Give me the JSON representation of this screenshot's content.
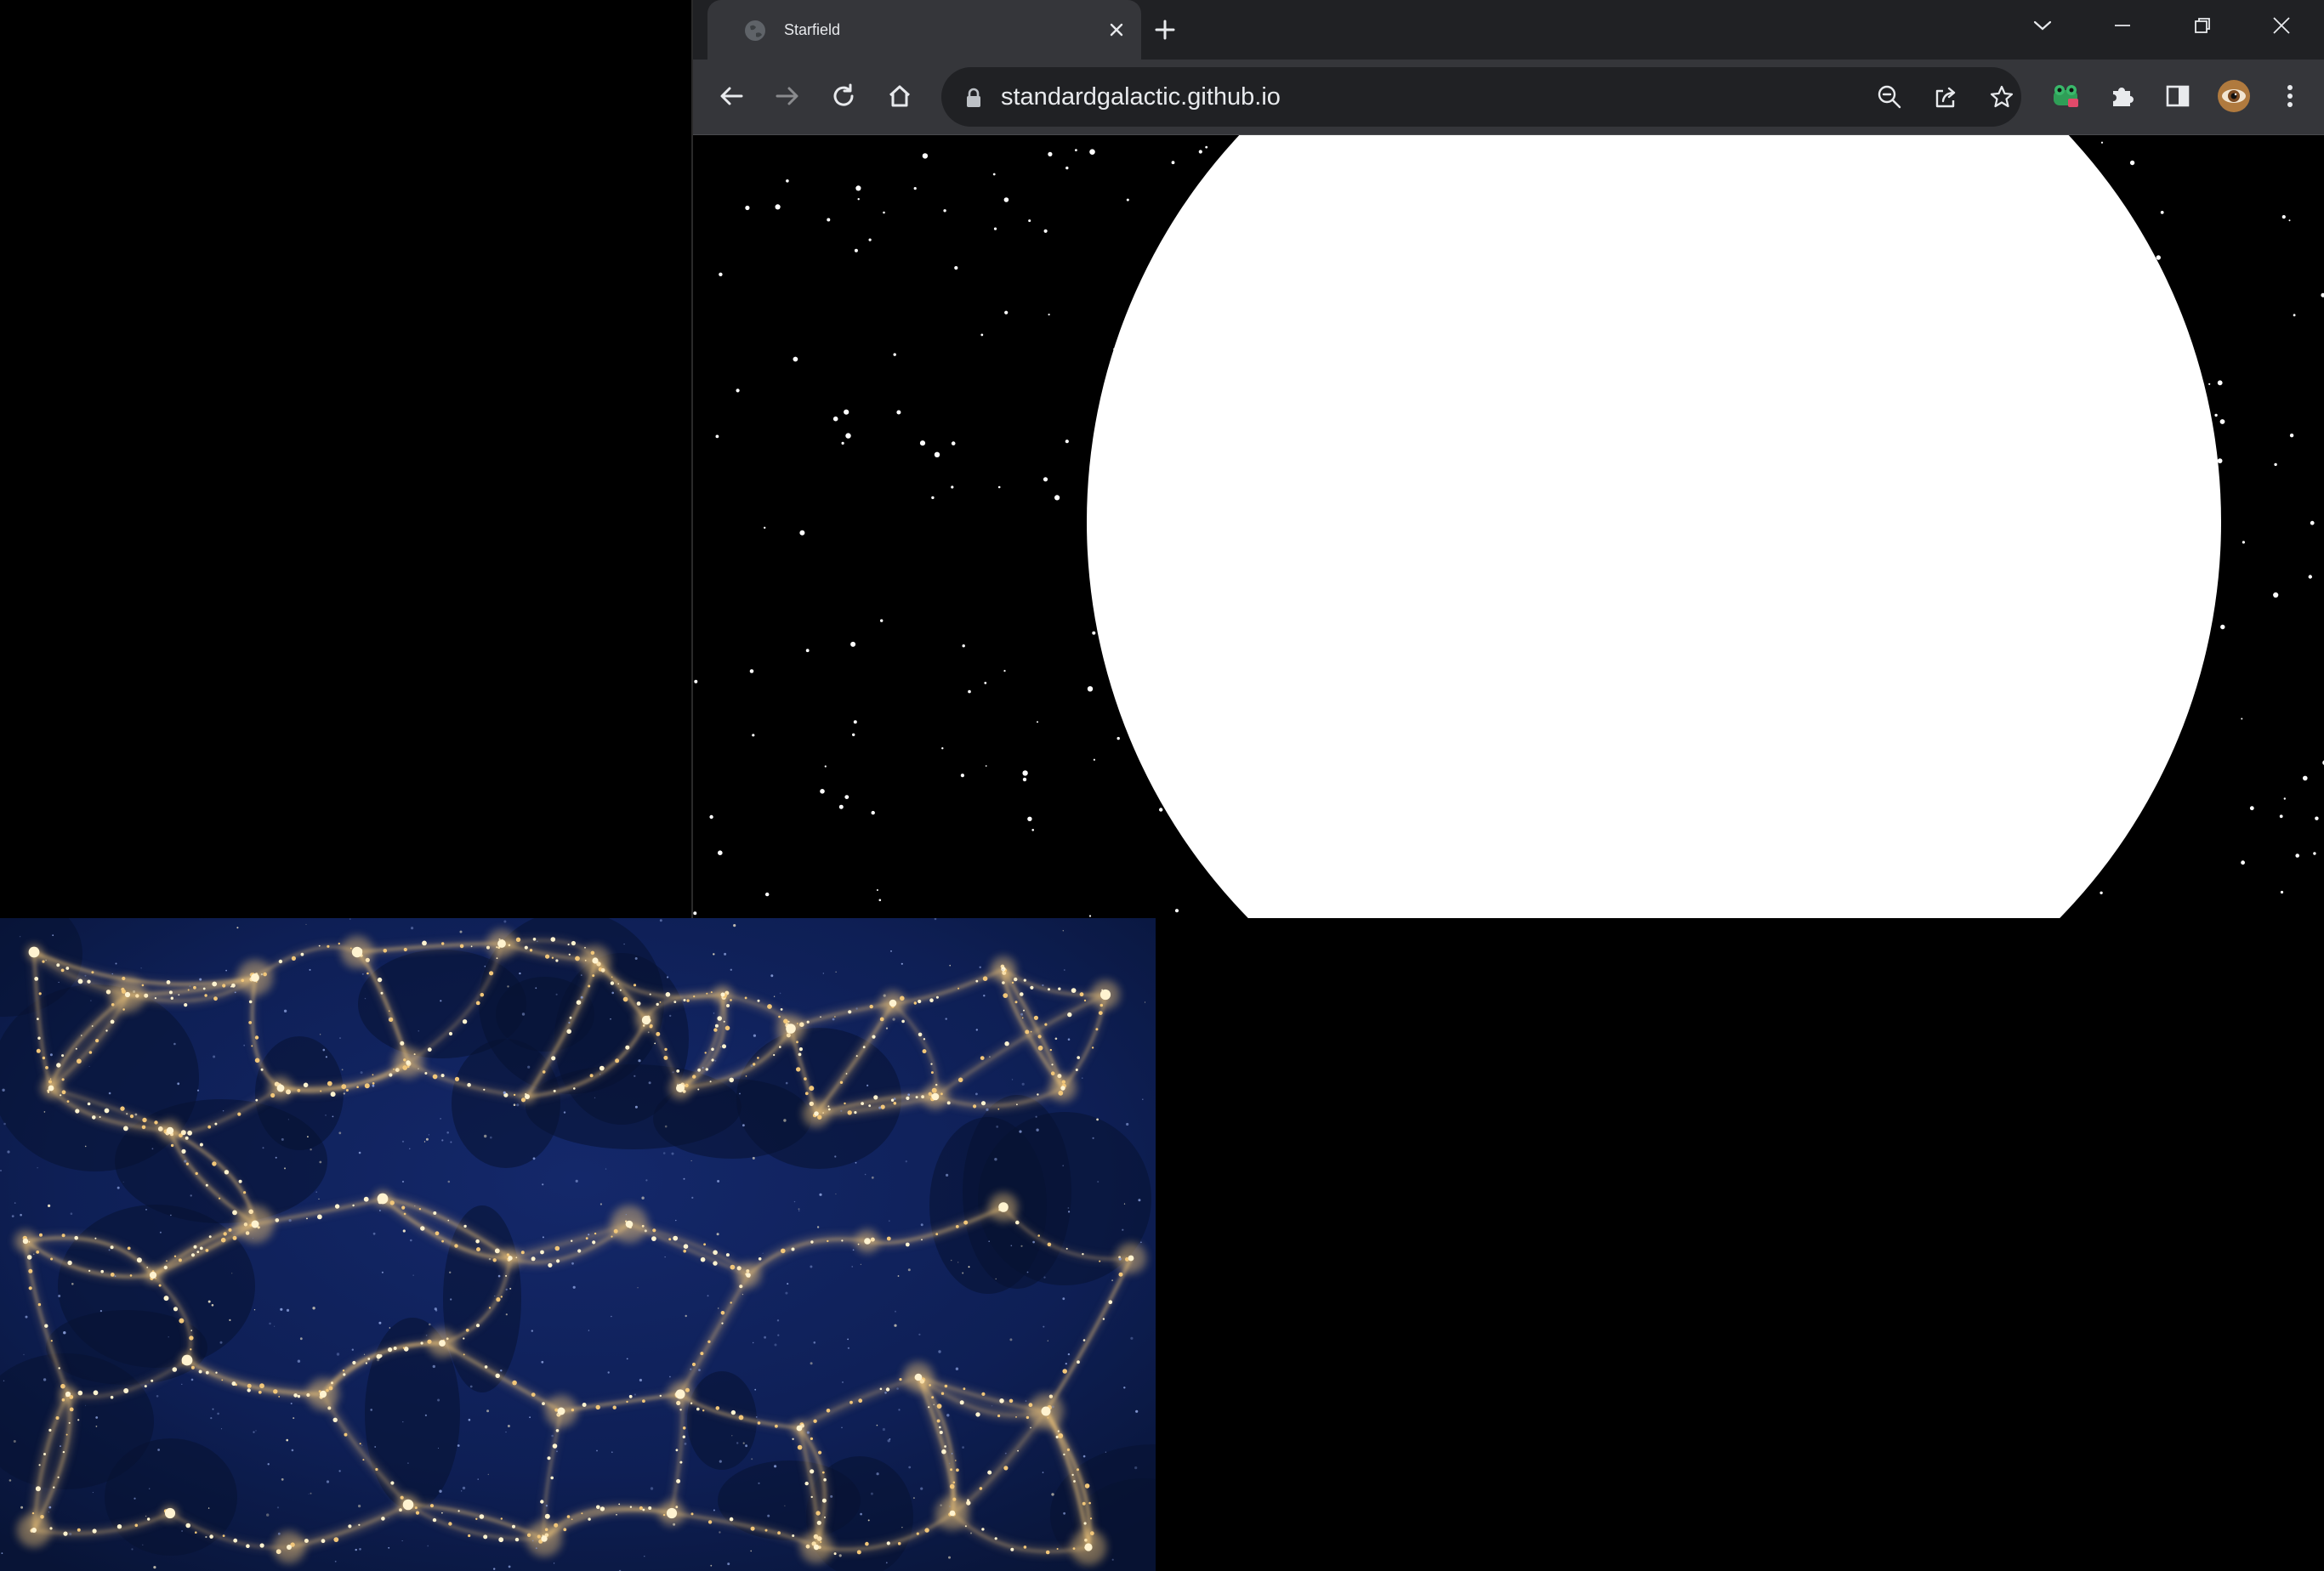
{
  "browser": {
    "tab": {
      "title": "Starfield",
      "favicon": "globe-icon"
    },
    "address_bar": {
      "url": "standardgalactic.github.io",
      "secure_icon": "lock-icon"
    },
    "toolbar_icons": [
      "back-arrow-icon",
      "forward-arrow-icon",
      "reload-icon",
      "home-icon"
    ],
    "omnibox_icons": [
      "zoom-out-icon",
      "share-icon",
      "bookmark-star-icon"
    ],
    "extension_icons": [
      "frog-extension-icon",
      "puzzle-extensions-icon",
      "side-panel-icon",
      "profile-avatar-icon",
      "menu-dots-icon"
    ],
    "window_controls": [
      "tab-search-chevron-icon",
      "minimize-icon",
      "restore-icon",
      "close-window-icon"
    ]
  },
  "page": {
    "description_shown": "starfield canvas with a large white sphere",
    "sphere_color": "#ffffff",
    "background_color": "#000000",
    "star_color": "#ffffff"
  },
  "desktop_image": {
    "subject": "cosmic web",
    "colors": {
      "background": "#0c1a45",
      "filaments": "#f2c77a",
      "highlights": "#fff3d0"
    }
  }
}
